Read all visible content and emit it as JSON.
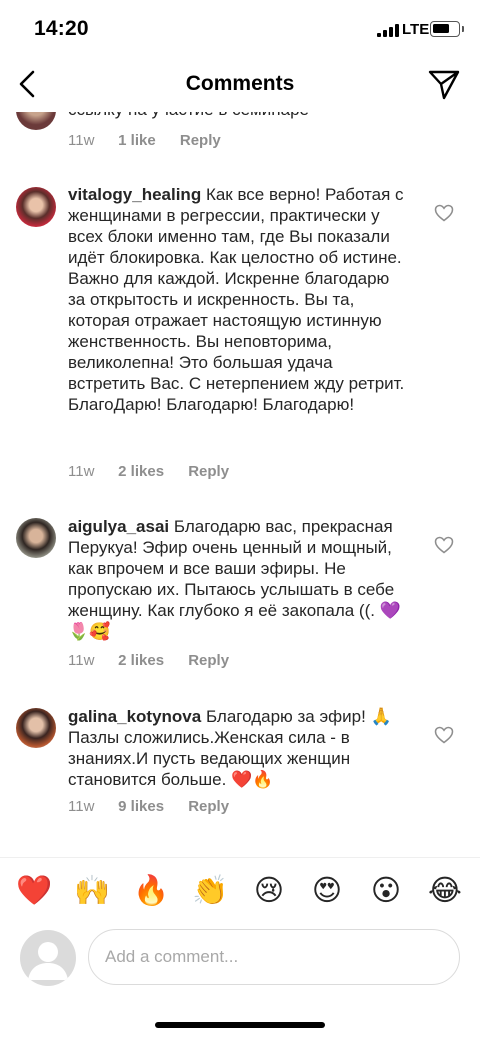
{
  "status_bar": {
    "time": "14:20",
    "network": "LTE",
    "icons": [
      "signal-icon",
      "battery-icon"
    ]
  },
  "header": {
    "title": "Comments",
    "back_icon": "chevron-left-icon",
    "send_icon": "paper-plane-icon"
  },
  "partial_comment": {
    "text_fragment": "ссылку на участие в семинаре",
    "time": "11w",
    "likes": "1 like",
    "reply": "Reply"
  },
  "comments": [
    {
      "username": "vitalogy_healing",
      "text": "Как все верно! Работая с женщинами в регрессии, практически у всех блоки именно там, где Вы показали идёт блокировка. Как целостно об истине. Важно для каждой. Искренне благодарю за открытость и искренность. Вы та, которая отражает настоящую истинную женственность. Вы неповторима, великолепна! Это большая удача встретить Вас. С нетерпением жду ретрит. БлагоДарю! Благодарю! Благодарю!",
      "time": "11w",
      "likes": "2 likes",
      "reply": "Reply"
    },
    {
      "username": "aigulya_asai",
      "text": "Благодарю вас, прекрасная Перукуа! Эфир очень ценный и мощный, как впрочем и все ваши эфиры. Не пропускаю их. Пытаюсь услышать в себе женщину. Как глубоко я её закопала ((. 💜🌷🥰",
      "time": "11w",
      "likes": "2 likes",
      "reply": "Reply"
    },
    {
      "username": "galina_kotynova",
      "text": "Благодарю за эфир! 🙏Пазлы сложились.Женская сила - в знаниях.И пусть ведающих женщин становится больше. ❤️🔥",
      "time": "11w",
      "likes": "9 likes",
      "reply": "Reply"
    }
  ],
  "emoji_bar": [
    "❤️",
    "🙌",
    "🔥",
    "👏",
    "😢",
    "😍",
    "😮",
    "😂"
  ],
  "composer": {
    "placeholder": "Add a comment..."
  },
  "colors": {
    "text": "#262626",
    "meta": "#8e8e8e",
    "border": "#dbdbdb"
  }
}
